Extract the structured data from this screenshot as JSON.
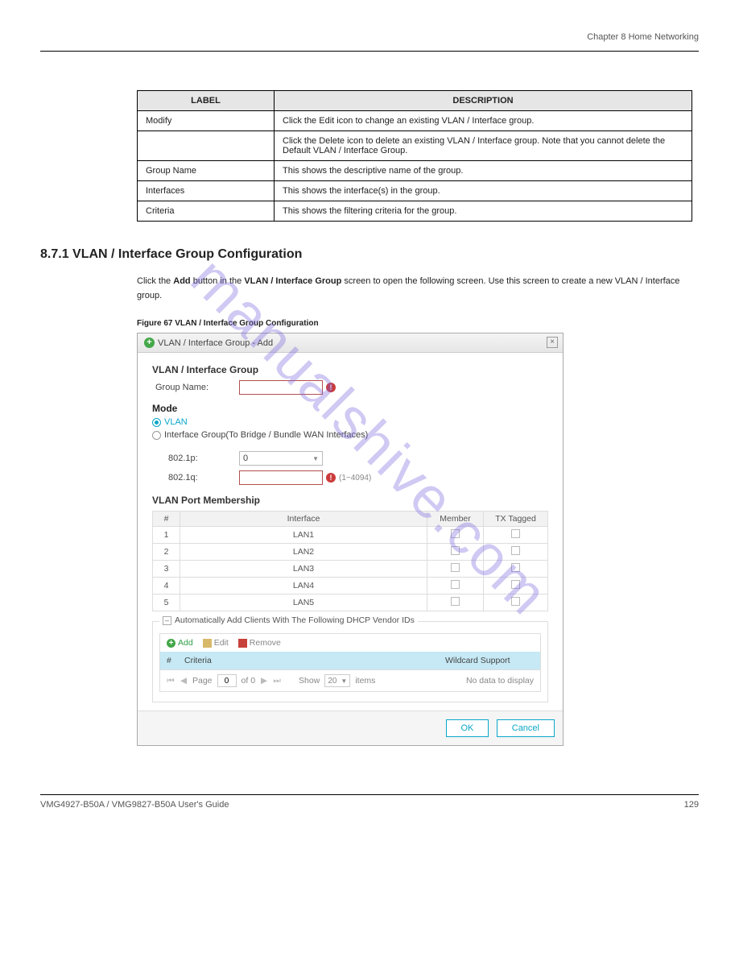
{
  "header": {
    "left": " ",
    "right": "Chapter 8 Home Networking"
  },
  "footer": {
    "left": "VMG4927-B50A / VMG9827-B50A User's Guide",
    "right": "129"
  },
  "summary": {
    "headLabel": "LABEL",
    "headDesc": "DESCRIPTION",
    "rows": [
      {
        "label": "Modify",
        "desc": "Click the Edit icon to change an existing VLAN / Interface group."
      },
      {
        "label": " ",
        "desc": "Click the Delete icon to delete an existing VLAN / Interface group. Note that you cannot delete the Default VLAN / Interface Group."
      },
      {
        "label": "Group Name",
        "desc": "This shows the descriptive name of the group."
      },
      {
        "label": "Interfaces",
        "desc": "This shows the interface(s) in the group."
      },
      {
        "label": "Criteria",
        "desc": "This shows the filtering criteria for the group."
      }
    ]
  },
  "section": {
    "number": "8.7.1  VLAN / Interface Group Configuration",
    "para": [
      "Click the ",
      "Add",
      " button in the ",
      "VLAN / Interface Group",
      " screen to open the following screen. Use this screen to create a new VLAN / Interface group."
    ]
  },
  "figure": {
    "caption": "Figure 67   VLAN / Interface Group Configuration"
  },
  "modal": {
    "title": "VLAN / Interface Group - Add",
    "formTitle": "VLAN / Interface Group",
    "groupNameLabel": "Group Name:",
    "modeTitle": "Mode",
    "radio1": "VLAN",
    "radio2": "Interface Group(To Bridge / Bundle WAN Interfaces)",
    "p8021p": {
      "label": "802.1p:",
      "value": "0"
    },
    "p8021q": {
      "label": "802.1q:",
      "hint": "(1~4094)"
    },
    "portTitle": "VLAN Port Membership",
    "portHeaders": {
      "num": "#",
      "iface": "Interface",
      "member": "Member",
      "tag": "TX Tagged"
    },
    "portRows": [
      {
        "n": "1",
        "iface": "LAN1"
      },
      {
        "n": "2",
        "iface": "LAN2"
      },
      {
        "n": "3",
        "iface": "LAN3"
      },
      {
        "n": "4",
        "iface": "LAN4"
      },
      {
        "n": "5",
        "iface": "LAN5"
      }
    ],
    "dhcpLegend": "Automatically Add Clients With The Following DHCP Vendor IDs",
    "toolbar": {
      "add": "Add",
      "edit": "Edit",
      "remove": "Remove"
    },
    "criteriaHead": {
      "num": "#",
      "crit": "Criteria",
      "wild": "Wildcard Support"
    },
    "pager": {
      "page": "Page",
      "of": "of 0",
      "pageVal": "0",
      "show": "Show",
      "itemsVal": "20",
      "items": "items",
      "nodata": "No data to display"
    },
    "buttons": {
      "ok": "OK",
      "cancel": "Cancel"
    }
  },
  "watermark": "manualshive.com"
}
